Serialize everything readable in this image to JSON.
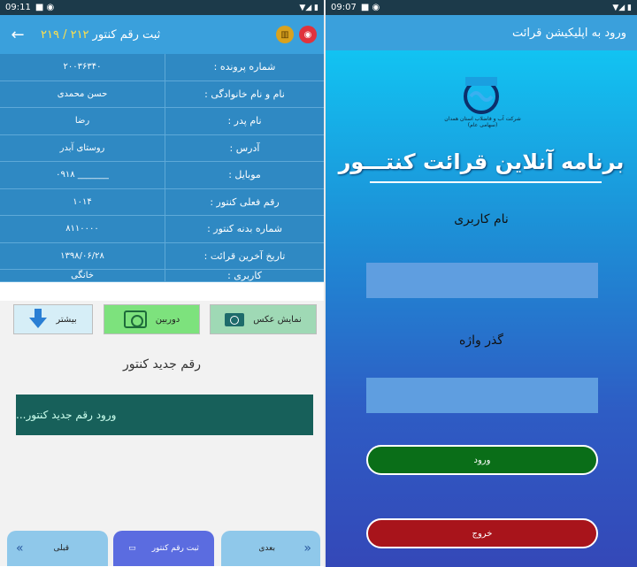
{
  "left": {
    "status": {
      "time": "09:11"
    },
    "header": {
      "title": "ثبت رقم کنتور",
      "count": "۲۱۹ / ۲۱۲"
    },
    "rows": [
      {
        "label": "شماره پرونده :",
        "value": "۲۰۰۳۶۳۴۰"
      },
      {
        "label": "نام و نام خانوادگی :",
        "value": "حسن محمدی"
      },
      {
        "label": "نام پدر :",
        "value": "رضا"
      },
      {
        "label": "آدرس :",
        "value": "روستای آبدر"
      },
      {
        "label": "موبایل :",
        "value": "۰۹۱۸ _______"
      },
      {
        "label": "رقم فعلی کنتور :",
        "value": "۱۰۱۴"
      },
      {
        "label": "شماره بدنه کنتور :",
        "value": "۸۱۱۰۰۰۰"
      },
      {
        "label": "تاریخ آخرین قرائت :",
        "value": "۱۳۹۸/۰۶/۲۸"
      },
      {
        "label": "کاربری :",
        "value": "خانگی"
      }
    ],
    "tools": {
      "photo_label": "نمایش عکس",
      "camera_label": "دوربین",
      "more_label": "بیشتر"
    },
    "new_reading": {
      "label": "رقم جدید کنتور",
      "placeholder": "ورود رقم جدید کنتور..."
    },
    "nav": {
      "prev": "قبلی",
      "save": "ثبت رقم کنتور",
      "next": "بعدی"
    }
  },
  "right": {
    "status": {
      "time": "09:07"
    },
    "header": {
      "title": "ورود به اپلیکیشن قرائت"
    },
    "logo_text": "شرکت آب و فاضلاب استان همدان",
    "logo_sub": "(سهامی عام)",
    "heading": "برنامه آنلاین قرائت کنتـــور",
    "username_label": "نام کاربری",
    "password_label": "گذر واژه",
    "login": "ورود",
    "exit": "خروج"
  },
  "colors": {
    "header": "#3aa0dc",
    "info_bg": "#2f89c3",
    "login": "#0a6e18",
    "exit": "#a8141b",
    "reading_input": "#17605a"
  }
}
